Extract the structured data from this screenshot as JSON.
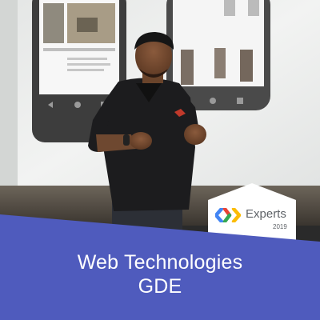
{
  "badge": {
    "label": "Experts",
    "year": "2019",
    "logo_icon": "google-developers-logo-icon",
    "colors": {
      "blue": "#4285f4",
      "red": "#ea4335",
      "green": "#34a853",
      "yellow": "#fbbc05"
    }
  },
  "banner": {
    "line1": "Web Technologies",
    "line2": "GDE",
    "color": "#4f5bbd"
  }
}
